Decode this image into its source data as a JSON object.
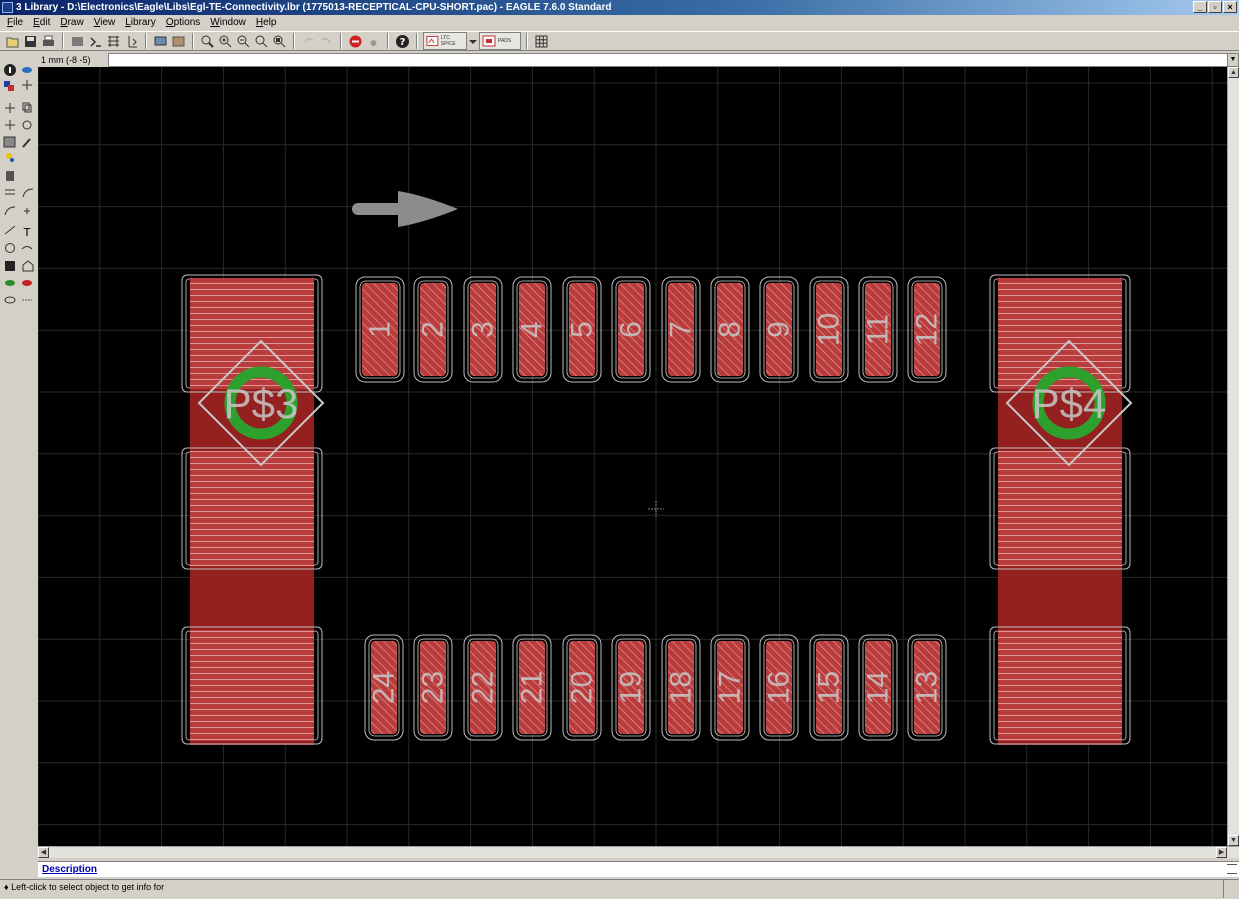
{
  "window": {
    "title": "3 Library - D:\\Electronics\\Eagle\\Libs\\Egl-TE-Connectivity.lbr (1775013-RECEPTICAL-CPU-SHORT.pac) - EAGLE 7.6.0 Standard",
    "minimize": "_",
    "restore": "▫",
    "close": "×"
  },
  "menu": [
    {
      "u": "F",
      "rest": "ile"
    },
    {
      "u": "E",
      "rest": "dit"
    },
    {
      "u": "D",
      "rest": "raw"
    },
    {
      "u": "V",
      "rest": "iew"
    },
    {
      "u": "L",
      "rest": "ibrary"
    },
    {
      "u": "O",
      "rest": "ptions"
    },
    {
      "u": "W",
      "rest": "indow"
    },
    {
      "u": "H",
      "rest": "elp"
    }
  ],
  "toolbar": {
    "spice_label": "LTC SPICE",
    "pads_label": "PADS"
  },
  "command": {
    "coordinate": "1 mm (-8 -5)",
    "value": ""
  },
  "canvas": {
    "pad_labels_top": [
      "1",
      "2",
      "3",
      "4",
      "5",
      "6",
      "7",
      "8",
      "9",
      "10",
      "11",
      "12"
    ],
    "pad_labels_bottom": [
      "24",
      "23",
      "22",
      "21",
      "20",
      "19",
      "18",
      "17",
      "16",
      "15",
      "14",
      "13"
    ],
    "mount_labels": [
      "P$3",
      "P$4"
    ],
    "colors": {
      "background": "#000000",
      "pad": "#b93c3c",
      "pad_fill_dark": "#952020",
      "hole_ring": "#2ea02e",
      "grid": "#2a2a2a",
      "arrow": "#8c8c8c"
    }
  },
  "description": {
    "link": "Description"
  },
  "status": {
    "text": "♦ Left-click to select object to get info for"
  }
}
